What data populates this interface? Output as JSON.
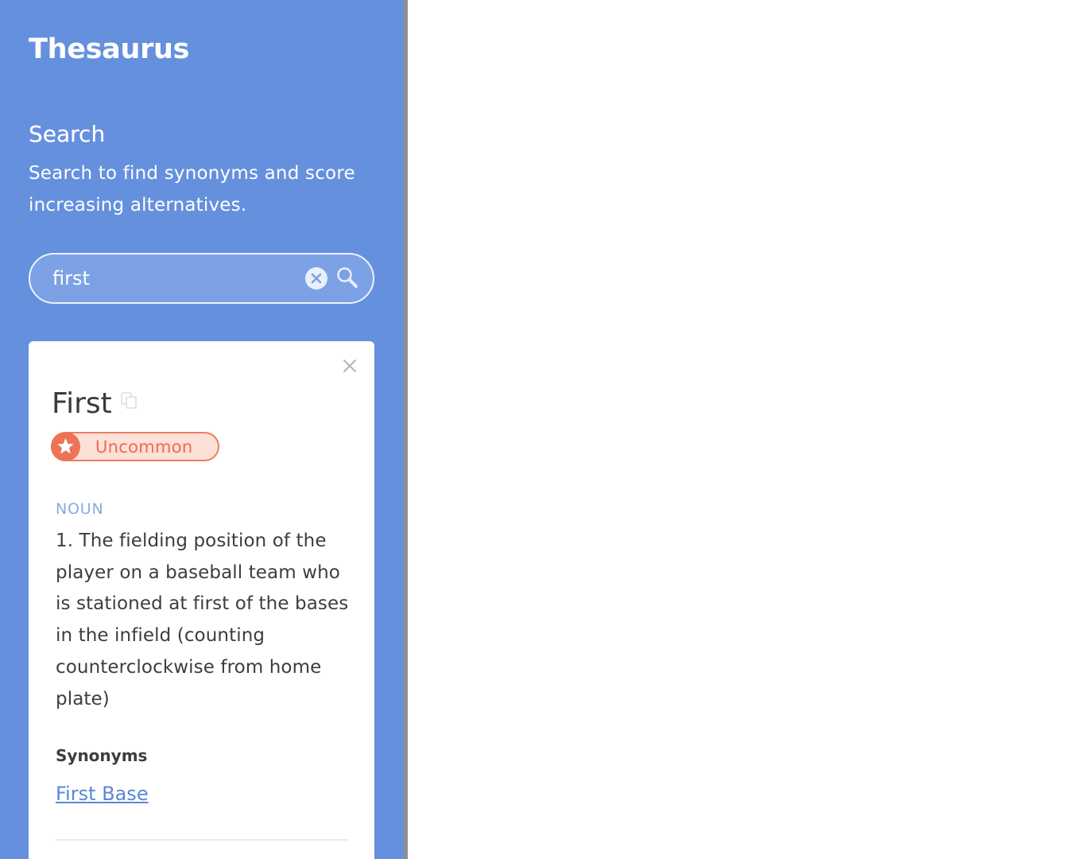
{
  "app": {
    "title": "Thesaurus"
  },
  "search": {
    "title": "Search",
    "description": "Search to find synonyms and score increasing alternatives.",
    "value": "first",
    "clear_icon": "close-circle-icon",
    "search_icon": "magnifier-icon"
  },
  "result": {
    "word": "First",
    "copy_icon": "copy-icon",
    "close_icon": "close-icon",
    "rarity": {
      "label": "Uncommon",
      "icon": "star-icon",
      "color": "#ee7356",
      "background": "#fde0d8"
    },
    "part_of_speech": "NOUN",
    "definition": "1. The fielding position of the player on a baseball team who is stationed at first of the bases in the infield (counting counterclockwise from home plate)",
    "synonyms_title": "Synonyms",
    "synonyms": [
      "First Base"
    ]
  },
  "colors": {
    "sidebar": "#6590de",
    "link": "#5a86d8",
    "pos_label": "#8da9e4"
  }
}
